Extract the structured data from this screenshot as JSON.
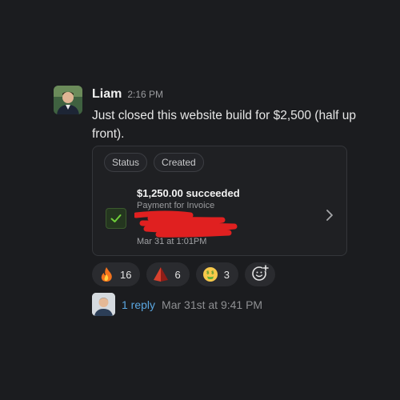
{
  "message": {
    "author": "Liam",
    "time": "2:16 PM",
    "text": "Just closed this website build for $2,500 (half up front)."
  },
  "payment_card": {
    "chips": [
      "Status",
      "Created"
    ],
    "amount_status": "$1,250.00 succeeded",
    "description": "Payment for Invoice",
    "created": "Mar 31 at 1:01PM",
    "status_icon": "checkmark-icon"
  },
  "reactions": [
    {
      "emoji": "fire",
      "count": "16"
    },
    {
      "emoji": "red-pyramid",
      "count": "6"
    },
    {
      "emoji": "money-mouth-face",
      "count": "3"
    }
  ],
  "thread": {
    "reply_label": "1 reply",
    "last_reply": "Mar 31st at 9:41 PM"
  },
  "colors": {
    "background": "#1b1c1f",
    "link": "#5aa6e0",
    "success": "#6fcf3a",
    "redaction": "#e02020"
  }
}
